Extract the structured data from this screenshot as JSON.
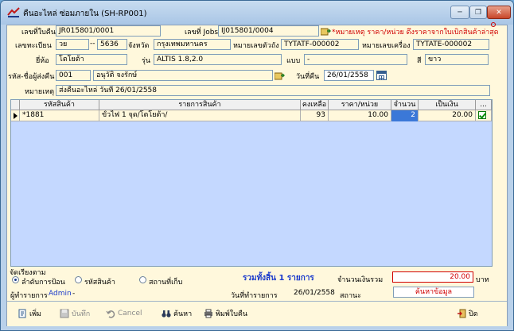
{
  "window": {
    "title": "คืนอะไหล่ ซ่อมภายใน (SH-RP001)",
    "controls": [
      "─",
      "❐",
      "✕"
    ]
  },
  "header": {
    "doc_no_label": "เลขที่ใบคืน",
    "doc_no": "JR015801/0001",
    "job_no_label": "เลขที่ Jobs",
    "job_no": "IJ015801/0004",
    "note": "*หมายเหตุ ราคา/หน่วย ดึงราคาจากใบเบิกสินค้าล่าสุด",
    "reg_label": "เลขทะเบียน",
    "reg_prefix": "วย",
    "reg_dash": "--",
    "reg_number": "5636",
    "province_label": "จังหวัด",
    "province": "กรุงเทพมหานคร",
    "chassis_label": "หมายเลขตัวถัง",
    "chassis": "TYTATF-000002",
    "engine_label": "หมายเลขเครื่อง",
    "engine": "TYTATE-000002",
    "brand_label": "ยี่ห้อ",
    "brand": "โตโยต้า",
    "model_label": "รุ่น",
    "model": "ALTIS 1.8,2.0",
    "type_label": "แบบ",
    "type": "-",
    "color_label": "สี",
    "color": "ขาว",
    "returner_code_label": "รหัส-ชื่อผู้ส่งคืน",
    "returner_code": "001",
    "returner_name": "อนุวัติ จงรักษ์",
    "return_date_label": "วันที่คืน",
    "return_date": "26/01/2558",
    "remark_label": "หมายเหตุ",
    "remark": "ส่งคืนอะไหล่ วันที่ 26/01/2558"
  },
  "grid": {
    "columns": [
      "รหัสสินค้า",
      "รายการสินค้า",
      "คงเหลือ",
      "ราคา/หน่วย",
      "จำนวน",
      "เป็นเงิน",
      "..."
    ],
    "rows": [
      {
        "code": "*1881",
        "name": "ขั้วไฟ 1 จุด/โตโยต้า/",
        "remaining": "93",
        "unit_price": "10.00",
        "qty": "2",
        "amount": "20.00"
      }
    ]
  },
  "sort": {
    "label": "จัดเรียงตาม",
    "options": [
      "ลำดับการป้อน",
      "รหัสสินค้า",
      "สถานที่เก็บ"
    ],
    "selected": 0
  },
  "summary": {
    "count_text": "รวมทั้งสิ้น 1 รายการ",
    "total_label": "จำนวนเงินรวม",
    "total": "20.00",
    "currency": "บาท",
    "maker_label": "ผู้ทำรายการ",
    "maker": "Admin",
    "maker_dash": "-",
    "made_date_label": "วันที่ทำรายการ",
    "made_date": "26/01/2558",
    "status_label": "สถานะ",
    "status": "ค้นหาข้อมูล"
  },
  "toolbar": {
    "add": "เพิ่ม",
    "save": "บันทึก",
    "cancel": "Cancel",
    "search": "ค้นหา",
    "print": "พิมพ์ใบคืน",
    "close": "ปิด"
  },
  "colors": {
    "field_bg": "#fff8dc",
    "grid_bg": "#c4d8ff",
    "accent_red": "#d00000",
    "accent_blue": "#1a3acc"
  }
}
